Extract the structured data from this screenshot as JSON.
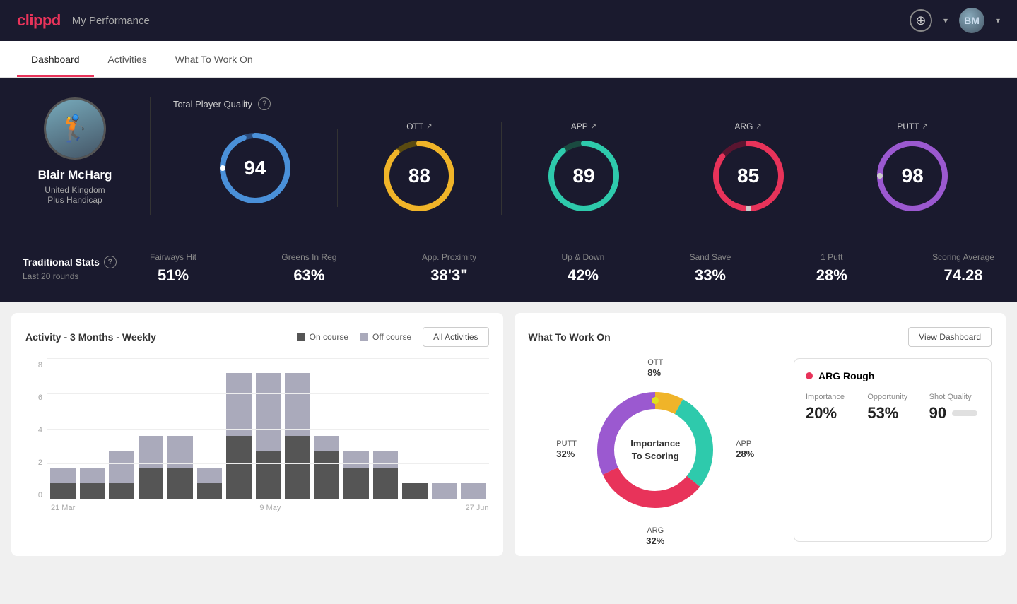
{
  "app": {
    "logo": "clippd",
    "title": "My Performance"
  },
  "nav": {
    "tabs": [
      {
        "label": "Dashboard",
        "active": true
      },
      {
        "label": "Activities",
        "active": false
      },
      {
        "label": "What To Work On",
        "active": false
      }
    ]
  },
  "header": {
    "add_label": "+",
    "avatar_initials": "BM"
  },
  "player": {
    "name": "Blair McHarg",
    "country": "United Kingdom",
    "handicap": "Plus Handicap"
  },
  "scores": {
    "section_label": "Total Player Quality",
    "items": [
      {
        "label": "TPQ",
        "value": "94",
        "color": "#4a90d9",
        "trail": "#2a4a7a",
        "percent": 94
      },
      {
        "label": "OTT",
        "value": "88",
        "color": "#f0b429",
        "trail": "#5a4a10",
        "percent": 88
      },
      {
        "label": "APP",
        "value": "89",
        "color": "#2ecaac",
        "trail": "#1a4a40",
        "percent": 89
      },
      {
        "label": "ARG",
        "value": "85",
        "color": "#e8335a",
        "trail": "#5a1530",
        "percent": 85
      },
      {
        "label": "PUTT",
        "value": "98",
        "color": "#9b59d0",
        "trail": "#3a1060",
        "percent": 98
      }
    ]
  },
  "traditional_stats": {
    "title": "Traditional Stats",
    "subtitle": "Last 20 rounds",
    "items": [
      {
        "label": "Fairways Hit",
        "value": "51%"
      },
      {
        "label": "Greens In Reg",
        "value": "63%"
      },
      {
        "label": "App. Proximity",
        "value": "38'3\""
      },
      {
        "label": "Up & Down",
        "value": "42%"
      },
      {
        "label": "Sand Save",
        "value": "33%"
      },
      {
        "label": "1 Putt",
        "value": "28%"
      },
      {
        "label": "Scoring Average",
        "value": "74.28"
      }
    ]
  },
  "activity_chart": {
    "title": "Activity - 3 Months - Weekly",
    "legend": [
      {
        "label": "On course",
        "color": "#555"
      },
      {
        "label": "Off course",
        "color": "#aab"
      }
    ],
    "button_label": "All Activities",
    "y_labels": [
      "0",
      "2",
      "4",
      "6",
      "8"
    ],
    "x_labels": [
      "21 Mar",
      "9 May",
      "27 Jun"
    ],
    "bars": [
      {
        "on": 1,
        "off": 1
      },
      {
        "on": 1,
        "off": 1
      },
      {
        "on": 1,
        "off": 2
      },
      {
        "on": 2,
        "off": 2
      },
      {
        "on": 2,
        "off": 2
      },
      {
        "on": 1,
        "off": 1
      },
      {
        "on": 4,
        "off": 4
      },
      {
        "on": 3,
        "off": 5
      },
      {
        "on": 4,
        "off": 4
      },
      {
        "on": 3,
        "off": 1
      },
      {
        "on": 2,
        "off": 1
      },
      {
        "on": 2,
        "off": 1
      },
      {
        "on": 1,
        "off": 0
      },
      {
        "on": 0,
        "off": 1
      },
      {
        "on": 0,
        "off": 1
      }
    ]
  },
  "what_to_work_on": {
    "title": "What To Work On",
    "button_label": "View Dashboard",
    "donut_center": "Importance\nTo Scoring",
    "segments": [
      {
        "label": "OTT",
        "percent": "8%",
        "color": "#f0b429"
      },
      {
        "label": "APP",
        "percent": "28%",
        "color": "#2ecaac"
      },
      {
        "label": "ARG",
        "percent": "32%",
        "color": "#e8335a"
      },
      {
        "label": "PUTT",
        "percent": "32%",
        "color": "#9b59d0"
      }
    ],
    "detail": {
      "title": "ARG Rough",
      "dot_color": "#e8335a",
      "metrics": [
        {
          "label": "Importance",
          "value": "20%"
        },
        {
          "label": "Opportunity",
          "value": "53%"
        },
        {
          "label": "Shot Quality",
          "value": "90"
        }
      ]
    }
  }
}
